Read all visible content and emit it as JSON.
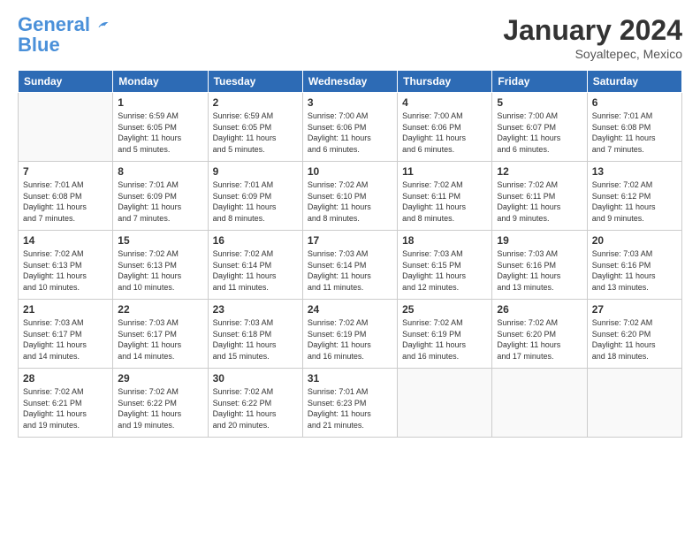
{
  "header": {
    "logo_line1": "General",
    "logo_line2": "Blue",
    "title": "January 2024",
    "location": "Soyaltepec, Mexico"
  },
  "weekdays": [
    "Sunday",
    "Monday",
    "Tuesday",
    "Wednesday",
    "Thursday",
    "Friday",
    "Saturday"
  ],
  "weeks": [
    [
      {
        "day": "",
        "info": ""
      },
      {
        "day": "1",
        "info": "Sunrise: 6:59 AM\nSunset: 6:05 PM\nDaylight: 11 hours\nand 5 minutes."
      },
      {
        "day": "2",
        "info": "Sunrise: 6:59 AM\nSunset: 6:05 PM\nDaylight: 11 hours\nand 5 minutes."
      },
      {
        "day": "3",
        "info": "Sunrise: 7:00 AM\nSunset: 6:06 PM\nDaylight: 11 hours\nand 6 minutes."
      },
      {
        "day": "4",
        "info": "Sunrise: 7:00 AM\nSunset: 6:06 PM\nDaylight: 11 hours\nand 6 minutes."
      },
      {
        "day": "5",
        "info": "Sunrise: 7:00 AM\nSunset: 6:07 PM\nDaylight: 11 hours\nand 6 minutes."
      },
      {
        "day": "6",
        "info": "Sunrise: 7:01 AM\nSunset: 6:08 PM\nDaylight: 11 hours\nand 7 minutes."
      }
    ],
    [
      {
        "day": "7",
        "info": "Sunrise: 7:01 AM\nSunset: 6:08 PM\nDaylight: 11 hours\nand 7 minutes."
      },
      {
        "day": "8",
        "info": "Sunrise: 7:01 AM\nSunset: 6:09 PM\nDaylight: 11 hours\nand 7 minutes."
      },
      {
        "day": "9",
        "info": "Sunrise: 7:01 AM\nSunset: 6:09 PM\nDaylight: 11 hours\nand 8 minutes."
      },
      {
        "day": "10",
        "info": "Sunrise: 7:02 AM\nSunset: 6:10 PM\nDaylight: 11 hours\nand 8 minutes."
      },
      {
        "day": "11",
        "info": "Sunrise: 7:02 AM\nSunset: 6:11 PM\nDaylight: 11 hours\nand 8 minutes."
      },
      {
        "day": "12",
        "info": "Sunrise: 7:02 AM\nSunset: 6:11 PM\nDaylight: 11 hours\nand 9 minutes."
      },
      {
        "day": "13",
        "info": "Sunrise: 7:02 AM\nSunset: 6:12 PM\nDaylight: 11 hours\nand 9 minutes."
      }
    ],
    [
      {
        "day": "14",
        "info": "Sunrise: 7:02 AM\nSunset: 6:13 PM\nDaylight: 11 hours\nand 10 minutes."
      },
      {
        "day": "15",
        "info": "Sunrise: 7:02 AM\nSunset: 6:13 PM\nDaylight: 11 hours\nand 10 minutes."
      },
      {
        "day": "16",
        "info": "Sunrise: 7:02 AM\nSunset: 6:14 PM\nDaylight: 11 hours\nand 11 minutes."
      },
      {
        "day": "17",
        "info": "Sunrise: 7:03 AM\nSunset: 6:14 PM\nDaylight: 11 hours\nand 11 minutes."
      },
      {
        "day": "18",
        "info": "Sunrise: 7:03 AM\nSunset: 6:15 PM\nDaylight: 11 hours\nand 12 minutes."
      },
      {
        "day": "19",
        "info": "Sunrise: 7:03 AM\nSunset: 6:16 PM\nDaylight: 11 hours\nand 13 minutes."
      },
      {
        "day": "20",
        "info": "Sunrise: 7:03 AM\nSunset: 6:16 PM\nDaylight: 11 hours\nand 13 minutes."
      }
    ],
    [
      {
        "day": "21",
        "info": "Sunrise: 7:03 AM\nSunset: 6:17 PM\nDaylight: 11 hours\nand 14 minutes."
      },
      {
        "day": "22",
        "info": "Sunrise: 7:03 AM\nSunset: 6:17 PM\nDaylight: 11 hours\nand 14 minutes."
      },
      {
        "day": "23",
        "info": "Sunrise: 7:03 AM\nSunset: 6:18 PM\nDaylight: 11 hours\nand 15 minutes."
      },
      {
        "day": "24",
        "info": "Sunrise: 7:02 AM\nSunset: 6:19 PM\nDaylight: 11 hours\nand 16 minutes."
      },
      {
        "day": "25",
        "info": "Sunrise: 7:02 AM\nSunset: 6:19 PM\nDaylight: 11 hours\nand 16 minutes."
      },
      {
        "day": "26",
        "info": "Sunrise: 7:02 AM\nSunset: 6:20 PM\nDaylight: 11 hours\nand 17 minutes."
      },
      {
        "day": "27",
        "info": "Sunrise: 7:02 AM\nSunset: 6:20 PM\nDaylight: 11 hours\nand 18 minutes."
      }
    ],
    [
      {
        "day": "28",
        "info": "Sunrise: 7:02 AM\nSunset: 6:21 PM\nDaylight: 11 hours\nand 19 minutes."
      },
      {
        "day": "29",
        "info": "Sunrise: 7:02 AM\nSunset: 6:22 PM\nDaylight: 11 hours\nand 19 minutes."
      },
      {
        "day": "30",
        "info": "Sunrise: 7:02 AM\nSunset: 6:22 PM\nDaylight: 11 hours\nand 20 minutes."
      },
      {
        "day": "31",
        "info": "Sunrise: 7:01 AM\nSunset: 6:23 PM\nDaylight: 11 hours\nand 21 minutes."
      },
      {
        "day": "",
        "info": ""
      },
      {
        "day": "",
        "info": ""
      },
      {
        "day": "",
        "info": ""
      }
    ]
  ]
}
